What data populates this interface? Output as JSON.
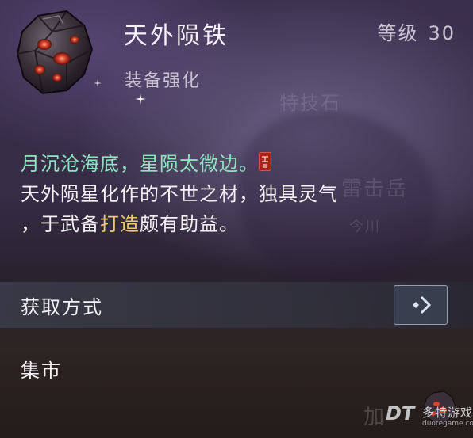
{
  "item": {
    "name": "天外陨铁",
    "category": "装备强化",
    "level_label": "等级",
    "level_value": "30",
    "icon": "meteorite-ore-icon"
  },
  "background": {
    "ghost_text_1": "特技石",
    "ghost_text_2": "雷击岳",
    "ghost_text_3": "今川"
  },
  "description": {
    "poem": "月沉沧海底，星陨太微边。",
    "line2": "天外陨星化作的不世之材，独具灵气",
    "line3_before": "，于武备",
    "line3_highlight": "打造",
    "line3_after": "颇有助益。"
  },
  "acquire": {
    "label": "获取方式",
    "button_icon": "chevron-right-icon"
  },
  "source": {
    "label": "集市"
  },
  "bottom": {
    "partial_text": "加"
  },
  "watermark": {
    "logo": "DT",
    "name": "多特游戏",
    "url": "duotegame.com"
  },
  "colors": {
    "poem": "#8fe3bd",
    "highlight": "#f0c870",
    "gem_red": "#d8402a"
  }
}
